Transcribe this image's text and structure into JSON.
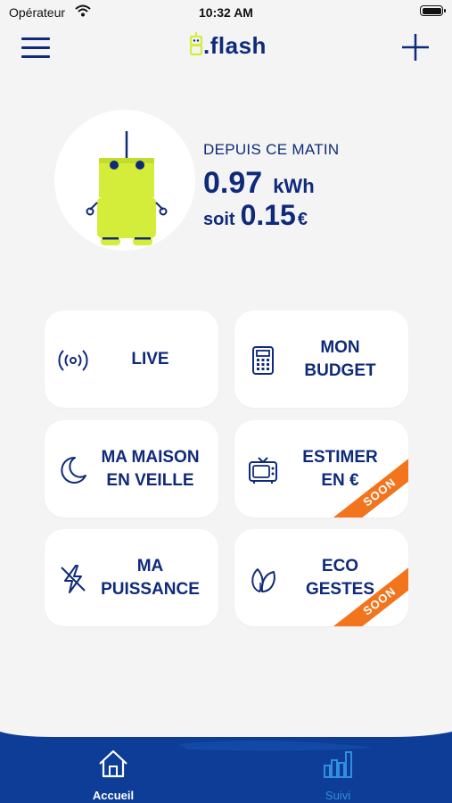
{
  "status_bar": {
    "carrier": "Opérateur",
    "time": "10:32 AM"
  },
  "header": {
    "logo_text": ".flash"
  },
  "summary": {
    "since_label": "DEPUIS CE MATIN",
    "kwh_value": "0.97",
    "kwh_unit": "kWh",
    "soit_label": "soit",
    "euro_value": "0.15",
    "euro_currency": "€"
  },
  "tiles": [
    {
      "label": "LIVE",
      "icon": "broadcast-icon"
    },
    {
      "label": "MON\nBUDGET",
      "icon": "calculator-icon"
    },
    {
      "label": "MA MAISON\nEN VEILLE",
      "icon": "moon-icon"
    },
    {
      "label": "ESTIMER\nEN €",
      "icon": "tv-icon",
      "badge": "SOON"
    },
    {
      "label": "MA\nPUISSANCE",
      "icon": "lightning-icon"
    },
    {
      "label": "ECO\nGESTES",
      "icon": "leaf-icon",
      "badge": "SOON"
    }
  ],
  "tab_bar": {
    "tabs": [
      {
        "label": "Accueil",
        "icon": "home-icon",
        "active": true
      },
      {
        "label": "Suivi",
        "icon": "bar-chart-icon",
        "active": false
      }
    ]
  },
  "colors": {
    "brand_blue": "#0f2a7a",
    "robot_yellow": "#d4ec3a",
    "soon_orange": "#f2751e",
    "tab_active": "#ffffff",
    "tab_inactive": "#2f8fe0"
  }
}
